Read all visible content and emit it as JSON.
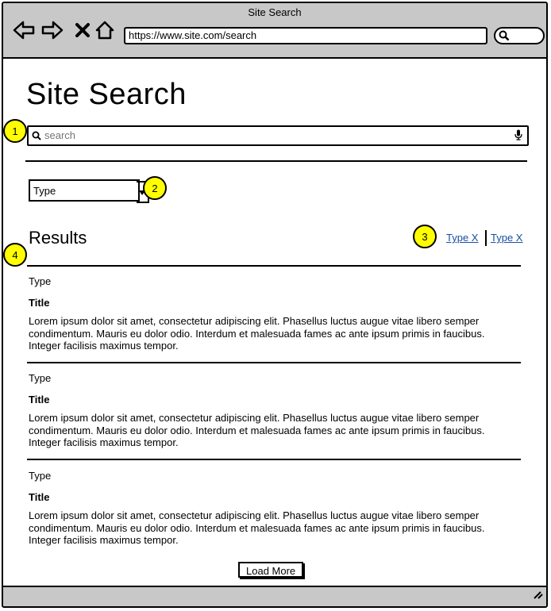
{
  "browser": {
    "window_title": "Site Search",
    "url": "https://www.site.com/search"
  },
  "page": {
    "title": "Site Search",
    "search_placeholder": "search",
    "type_select_value": "Type",
    "results_heading": "Results",
    "filter_links": [
      "Type X",
      "Type X"
    ],
    "results": [
      {
        "type": "Type",
        "title": "Title",
        "description": "Lorem ipsum dolor sit amet, consectetur adipiscing elit. Phasellus luctus augue vitae libero semper condimentum. Mauris eu dolor odio. Interdum et malesuada fames ac ante ipsum primis in faucibus. Integer facilisis maximus tempor."
      },
      {
        "type": "Type",
        "title": "Title",
        "description": "Lorem ipsum dolor sit amet, consectetur adipiscing elit. Phasellus luctus augue vitae libero semper condimentum. Mauris eu dolor odio. Interdum et malesuada fames ac ante ipsum primis in faucibus. Integer facilisis maximus tempor."
      },
      {
        "type": "Type",
        "title": "Title",
        "description": "Lorem ipsum dolor sit amet, consectetur adipiscing elit. Phasellus luctus augue vitae libero semper condimentum. Mauris eu dolor odio. Interdum et malesuada fames ac ante ipsum primis in faucibus. Integer facilisis maximus tempor."
      }
    ],
    "load_more_label": "Load More"
  },
  "callouts": [
    "1",
    "2",
    "3",
    "4"
  ],
  "colors": {
    "chrome": "#c8c8c8",
    "link": "#1a4fa0",
    "callout": "#ffff00"
  }
}
